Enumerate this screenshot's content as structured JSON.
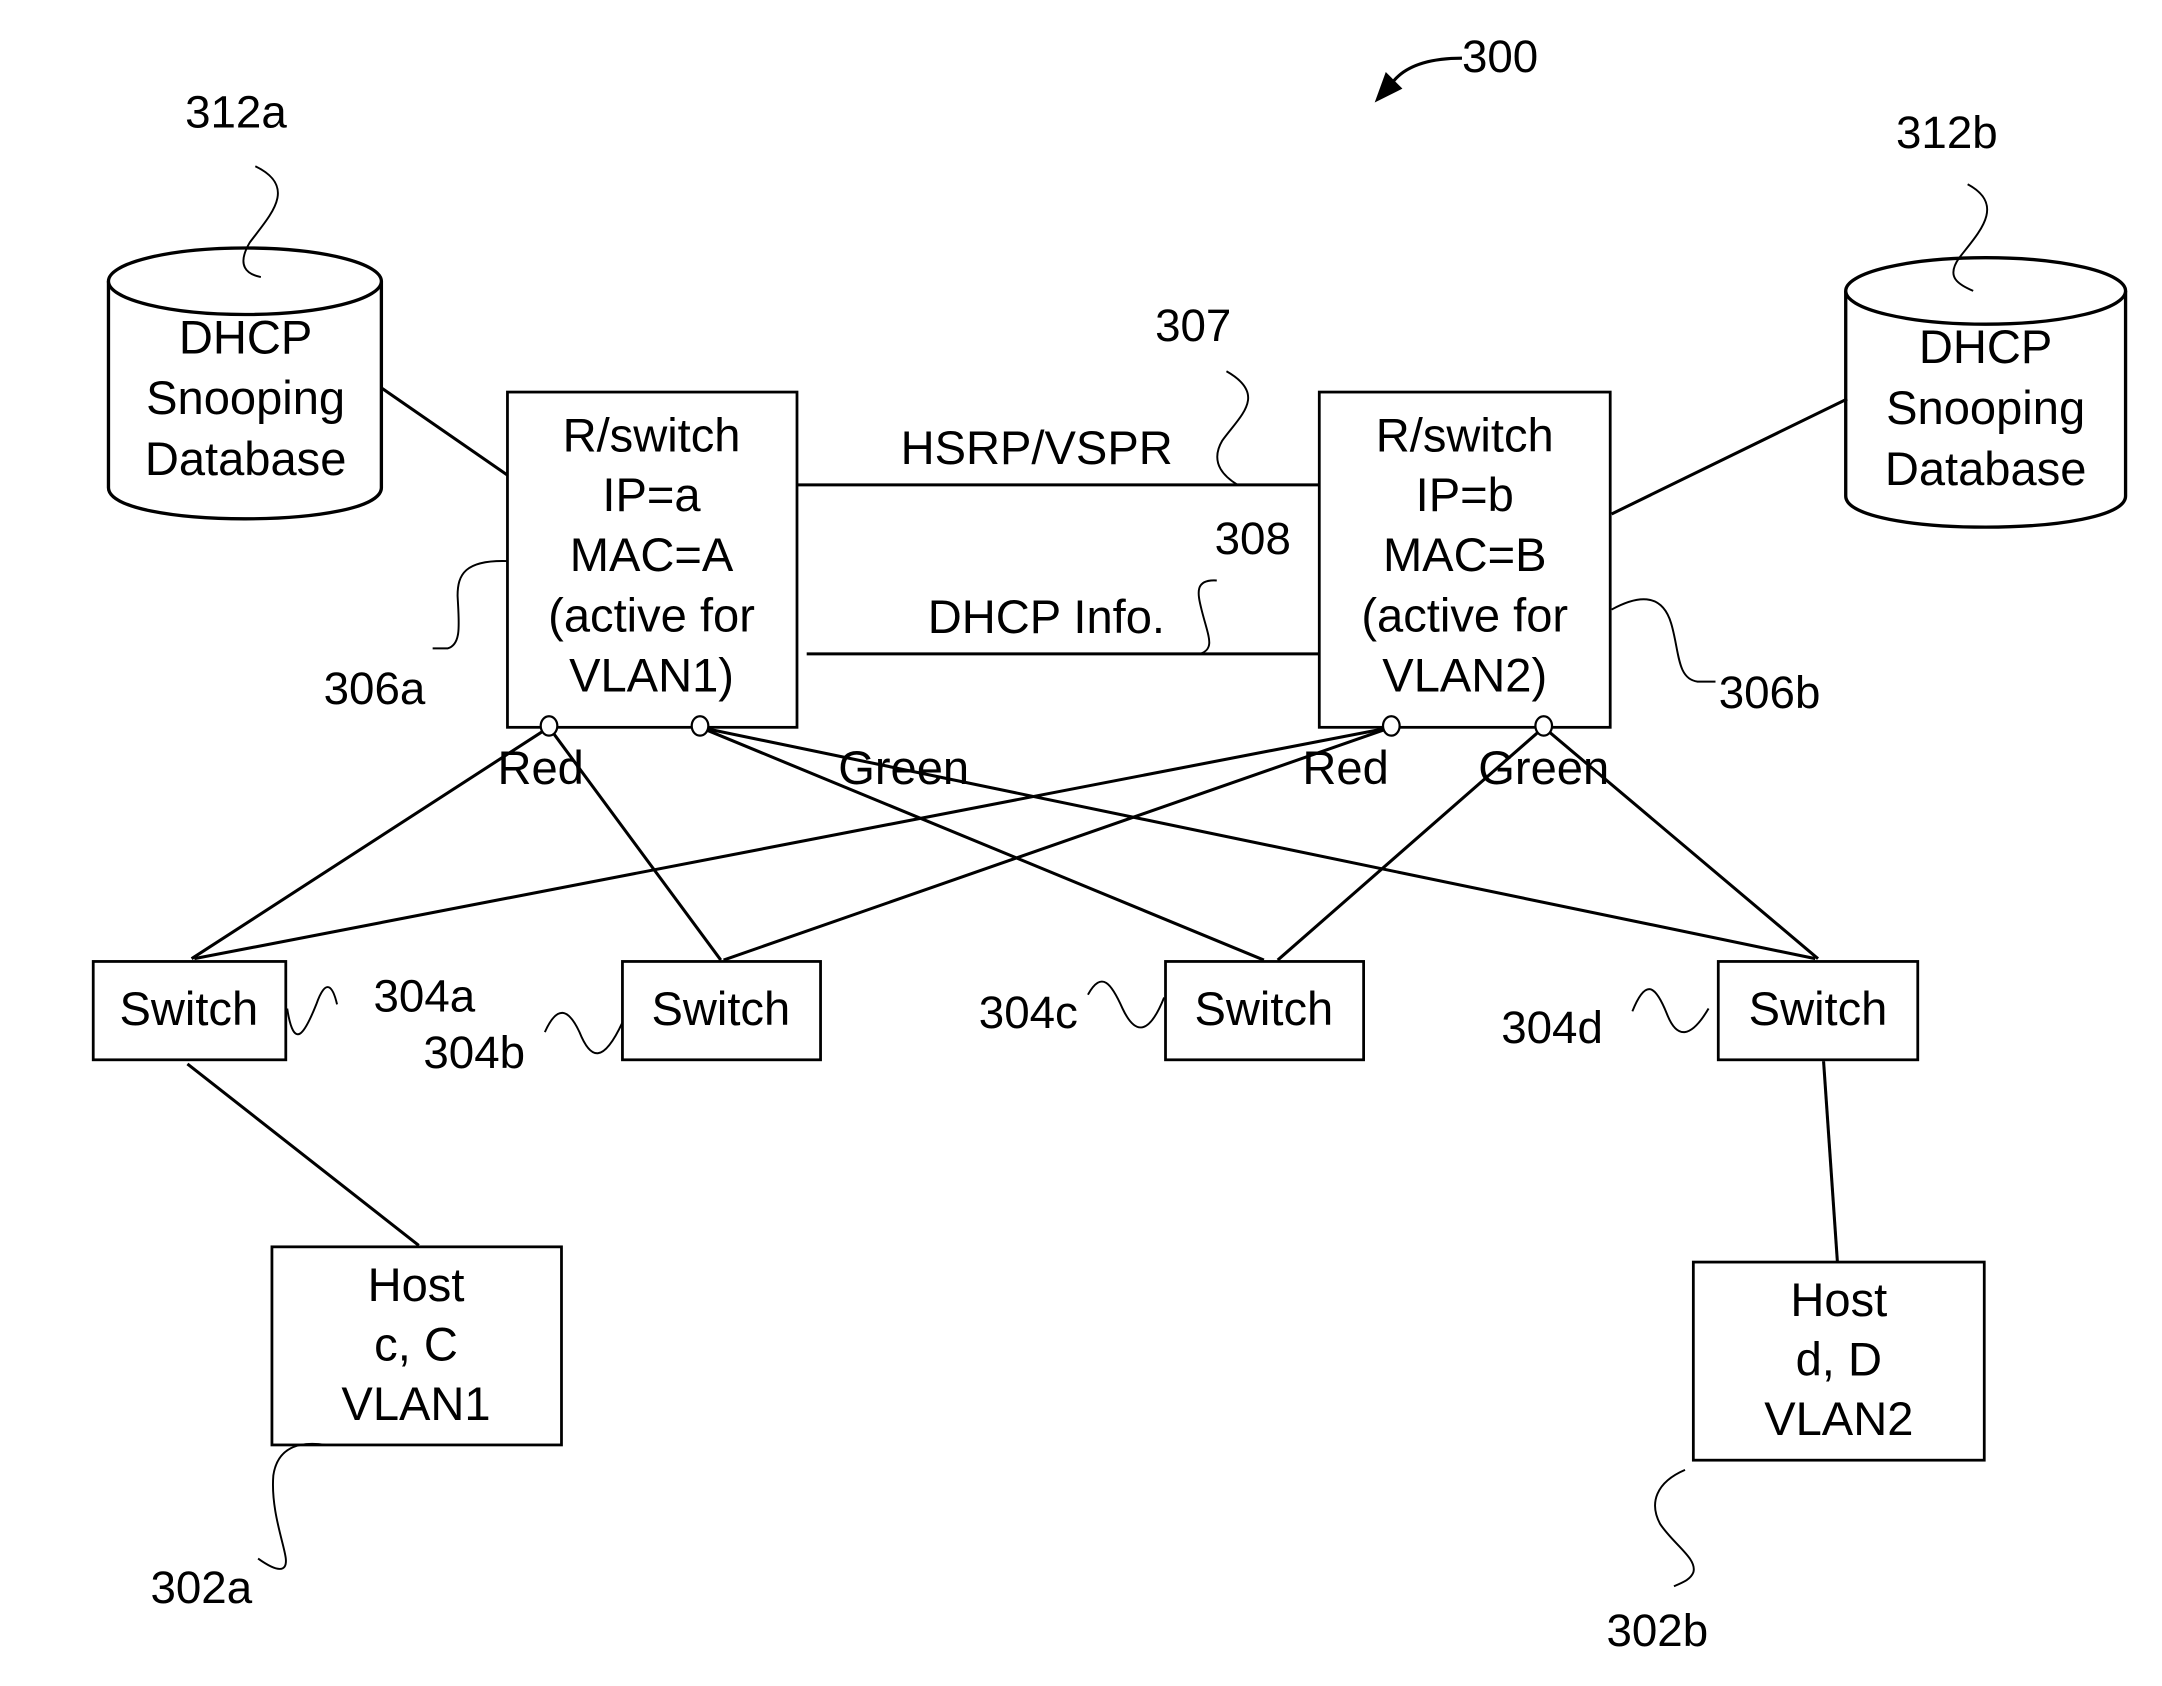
{
  "figure": {
    "ref": "300",
    "databases": [
      {
        "ref": "312a",
        "lines": [
          "DHCP",
          "Snooping",
          "Database"
        ]
      },
      {
        "ref": "312b",
        "lines": [
          "DHCP",
          "Snooping",
          "Database"
        ]
      }
    ],
    "routers": [
      {
        "ref": "306a",
        "lines": [
          "R/switch",
          "IP=a",
          "MAC=A",
          "(active for",
          "VLAN1)"
        ],
        "ports": [
          {
            "label": "Red"
          },
          {
            "label": "Green"
          }
        ]
      },
      {
        "ref": "306b",
        "lines": [
          "R/switch",
          "IP=b",
          "MAC=B",
          "(active for",
          "VLAN2)"
        ],
        "ports": [
          {
            "label": "Red"
          },
          {
            "label": "Green"
          }
        ]
      }
    ],
    "links": [
      {
        "ref": "307",
        "label": "HSRP/VSPR"
      },
      {
        "ref": "308",
        "label": "DHCP Info."
      }
    ],
    "switches": [
      {
        "ref": "304a",
        "label": "Switch"
      },
      {
        "ref": "304b",
        "label": "Switch"
      },
      {
        "ref": "304c",
        "label": "Switch"
      },
      {
        "ref": "304d",
        "label": "Switch"
      }
    ],
    "hosts": [
      {
        "ref": "302a",
        "lines": [
          "Host",
          "c, C",
          "VLAN1"
        ]
      },
      {
        "ref": "302b",
        "lines": [
          "Host",
          "d, D",
          "VLAN2"
        ]
      }
    ]
  }
}
